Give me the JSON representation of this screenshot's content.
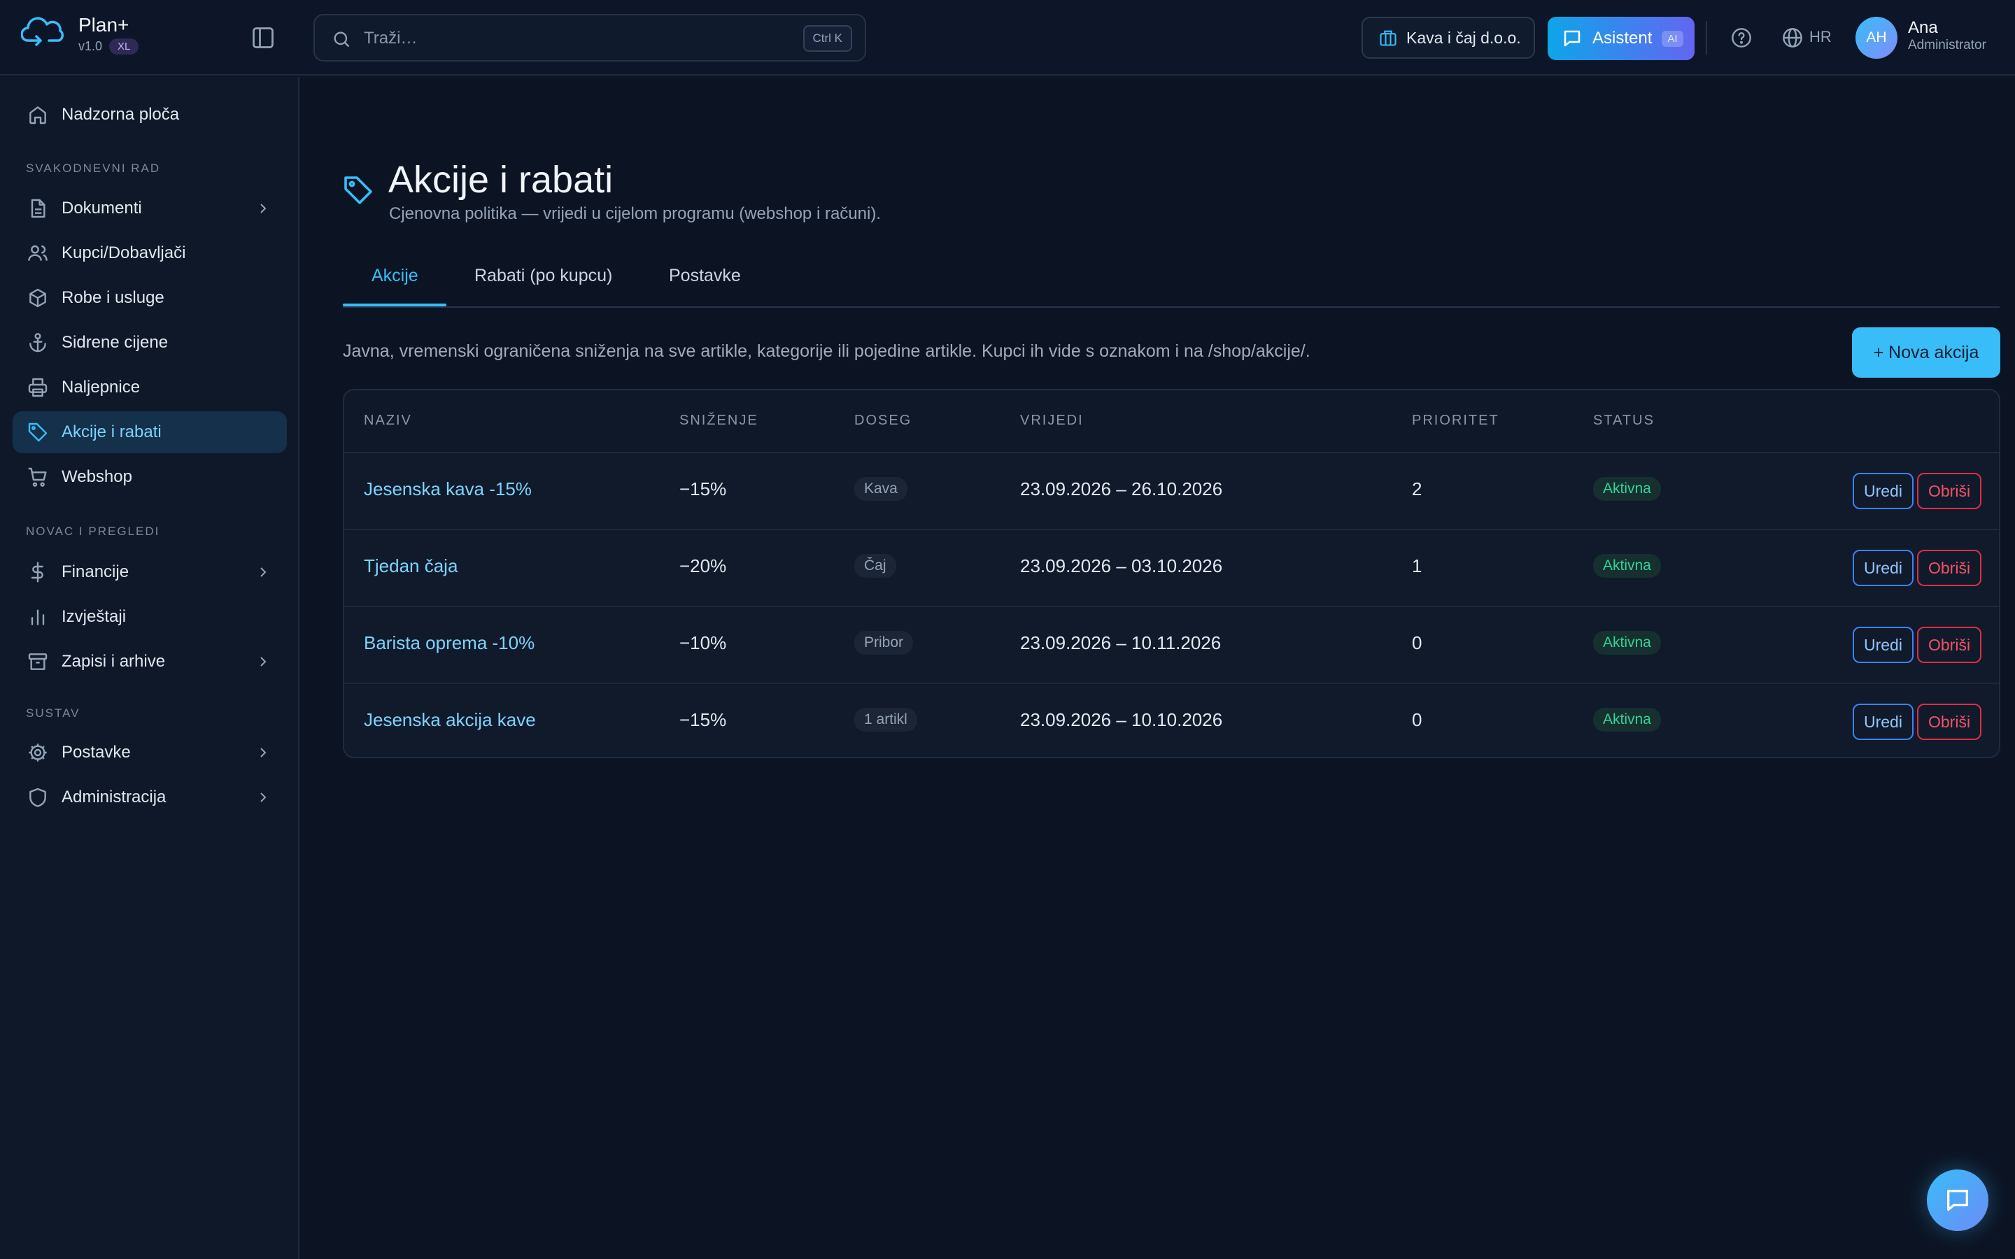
{
  "app": {
    "name": "Plan+",
    "version": "v1.0",
    "badge": "XL"
  },
  "search": {
    "placeholder": "Traži…",
    "shortcut": "Ctrl K"
  },
  "header": {
    "company": "Kava i čaj d.o.o.",
    "assistant_label": "Asistent",
    "assistant_badge": "AI",
    "language": "HR",
    "user": {
      "initials": "AH",
      "name": "Ana",
      "role": "Administrator"
    }
  },
  "sidebar": {
    "dashboard": "Nadzorna ploča",
    "sections": [
      {
        "title": "SVAKODNEVNI RAD"
      },
      {
        "title": "NOVAC I PREGLEDI"
      },
      {
        "title": "SUSTAV"
      }
    ],
    "items": [
      {
        "label": "Dokumenti",
        "icon": "file-icon"
      },
      {
        "label": "Kupci/Dobavljači",
        "icon": "users-icon"
      },
      {
        "label": "Robe i usluge",
        "icon": "box-icon"
      },
      {
        "label": "Sidrene cijene",
        "icon": "anchor-icon"
      },
      {
        "label": "Naljepnice",
        "icon": "printer-icon"
      },
      {
        "label": "Akcije i rabati",
        "icon": "tag-icon",
        "active": true
      },
      {
        "label": "Webshop",
        "icon": "cart-icon"
      },
      {
        "label": "Financije",
        "icon": "dollar-icon"
      },
      {
        "label": "Izvještaji",
        "icon": "bar-chart-icon"
      },
      {
        "label": "Zapisi i arhive",
        "icon": "archive-icon"
      },
      {
        "label": "Postavke",
        "icon": "gear-icon"
      },
      {
        "label": "Administracija",
        "icon": "shield-icon"
      }
    ]
  },
  "page": {
    "title": "Akcije i rabati",
    "subtitle": "Cjenovna politika — vrijedi u cijelom programu (webshop i računi).",
    "tabs": [
      {
        "label": "Akcije",
        "active": true
      },
      {
        "label": "Rabati (po kupcu)"
      },
      {
        "label": "Postavke"
      }
    ],
    "description": "Javna, vremenski ograničena sniženja na sve artikle, kategorije ili pojedine artikle. Kupci ih vide s oznakom i na /shop/akcije/.",
    "new_button": "+ Nova akcija"
  },
  "table": {
    "headers": [
      "NAZIV",
      "SNIŽENJE",
      "DOSEG",
      "VRIJEDI",
      "PRIORITET",
      "STATUS"
    ],
    "edit_label": "Uredi",
    "delete_label": "Obriši",
    "rows": [
      {
        "name": "Jesenska kava -15%",
        "discount": "−15%",
        "scope": "Kava",
        "valid": "23.09.2026 – 26.10.2026",
        "priority": "2",
        "status": "Aktivna"
      },
      {
        "name": "Tjedan čaja",
        "discount": "−20%",
        "scope": "Čaj",
        "valid": "23.09.2026 – 03.10.2026",
        "priority": "1",
        "status": "Aktivna"
      },
      {
        "name": "Barista oprema -10%",
        "discount": "−10%",
        "scope": "Pribor",
        "valid": "23.09.2026 – 10.11.2026",
        "priority": "0",
        "status": "Aktivna"
      },
      {
        "name": "Jesenska akcija kave",
        "discount": "−15%",
        "scope": "1 artikl",
        "valid": "23.09.2026 – 10.10.2026",
        "priority": "0",
        "status": "Aktivna"
      }
    ]
  },
  "colors": {
    "accent": "#38bdf8",
    "background": "#0c1424",
    "success": "#34d399",
    "danger": "#f05266"
  }
}
